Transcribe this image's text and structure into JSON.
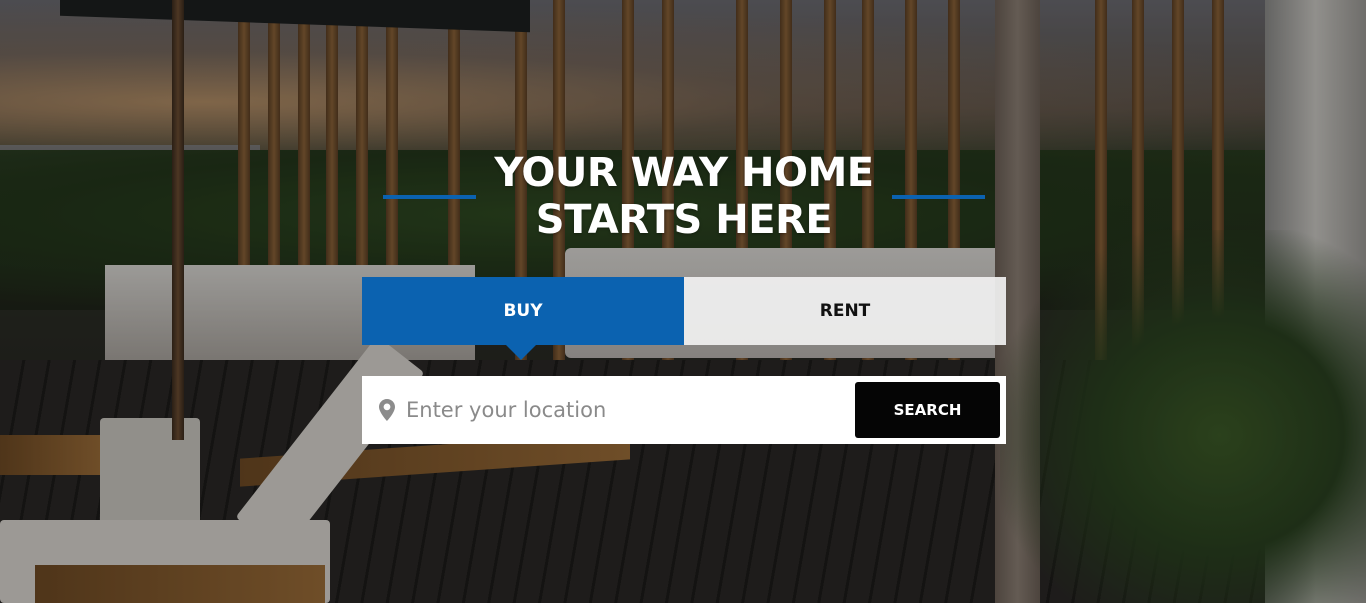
{
  "hero": {
    "headline_line1": "YOUR WAY HOME",
    "headline_line2": "STARTS HERE",
    "accent_color": "#0b62b0"
  },
  "tabs": [
    {
      "label": "BUY",
      "active": true
    },
    {
      "label": "RENT",
      "active": false
    }
  ],
  "search": {
    "placeholder": "Enter your location",
    "value": "",
    "button_label": "SEARCH",
    "icon": "map-pin-icon"
  }
}
